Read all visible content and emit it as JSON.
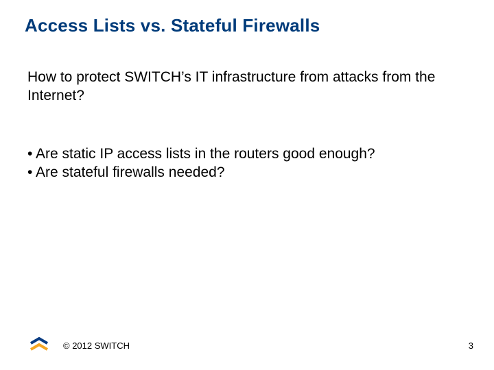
{
  "slide": {
    "title": "Access Lists vs. Stateful Firewalls",
    "intro": "How to protect SWITCH’s IT infrastructure from attacks from the Internet?",
    "bullets": [
      "• Are static IP access lists in the routers good enough?",
      "• Are stateful firewalls needed?"
    ],
    "footer": {
      "copyright": "© 2012 SWITCH",
      "page_number": "3"
    },
    "accent_colors": {
      "title": "#003b7a",
      "logo_blue": "#0a3c82",
      "logo_orange": "#f5a623"
    }
  }
}
